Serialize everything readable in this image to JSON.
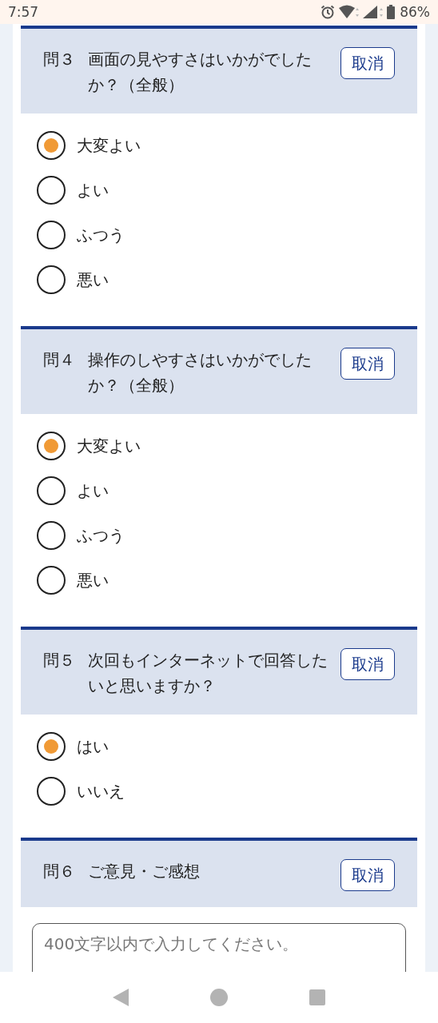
{
  "status_bar": {
    "time": "7:57",
    "battery": "86%"
  },
  "questions": [
    {
      "number": "問３",
      "text": "画面の見やすさはいかがでしたか？（全般）",
      "cancel": "取消",
      "kind": "radio",
      "options": [
        {
          "label": "大変よい",
          "selected": true
        },
        {
          "label": "よい",
          "selected": false
        },
        {
          "label": "ふつう",
          "selected": false
        },
        {
          "label": "悪い",
          "selected": false
        }
      ]
    },
    {
      "number": "問４",
      "text": "操作のしやすさはいかがでしたか？（全般）",
      "cancel": "取消",
      "kind": "radio",
      "options": [
        {
          "label": "大変よい",
          "selected": true
        },
        {
          "label": "よい",
          "selected": false
        },
        {
          "label": "ふつう",
          "selected": false
        },
        {
          "label": "悪い",
          "selected": false
        }
      ]
    },
    {
      "number": "問５",
      "text": "次回もインターネットで回答したいと思いますか？",
      "cancel": "取消",
      "kind": "radio",
      "options": [
        {
          "label": "はい",
          "selected": true
        },
        {
          "label": "いいえ",
          "selected": false
        }
      ]
    },
    {
      "number": "問６",
      "text": "ご意見・ご感想",
      "cancel": "取消",
      "kind": "text",
      "placeholder": "400文字以内で入力してください。"
    }
  ]
}
